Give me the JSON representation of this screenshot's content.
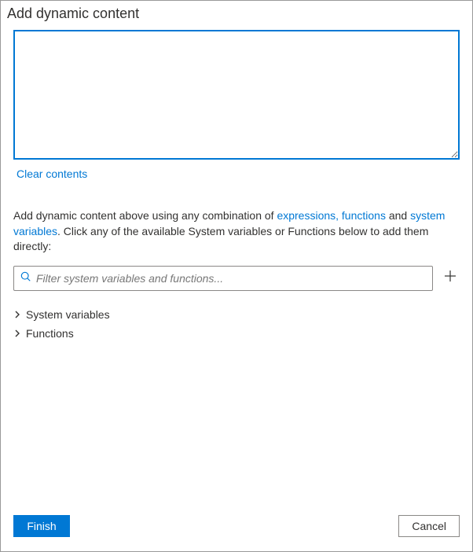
{
  "header": {
    "title": "Add dynamic content"
  },
  "editor": {
    "value": "",
    "placeholder": ""
  },
  "clear": {
    "label": "Clear contents"
  },
  "help": {
    "prefix": "Add dynamic content above using any combination of ",
    "expressions_link": "expressions, functions",
    "middle": " and ",
    "sysvars_link": "system variables",
    "suffix": ". Click any of the available System variables or Functions below to add them directly:"
  },
  "search": {
    "placeholder": "Filter system variables and functions..."
  },
  "tree": {
    "items": [
      {
        "label": "System variables"
      },
      {
        "label": "Functions"
      }
    ]
  },
  "footer": {
    "finish": "Finish",
    "cancel": "Cancel"
  }
}
